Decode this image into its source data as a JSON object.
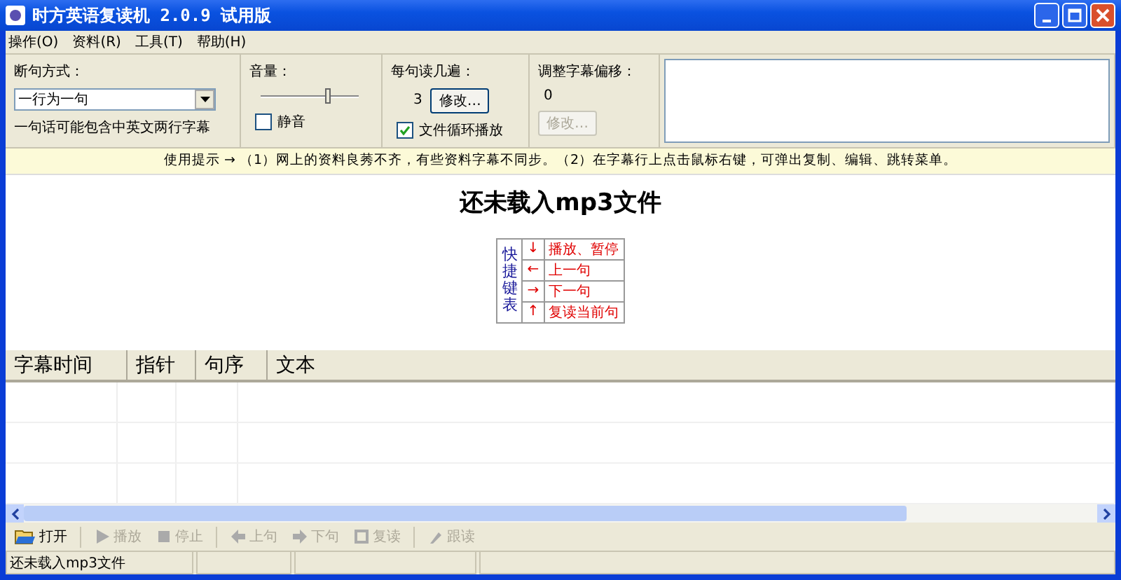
{
  "window": {
    "title": "时方英语复读机 2.0.9 试用版"
  },
  "menu": [
    "操作(O)",
    "资料(R)",
    "工具(T)",
    "帮助(H)"
  ],
  "split_mode": {
    "label": "断句方式：",
    "value": "一行为一句",
    "note": "一句话可能包含中英文两行字幕"
  },
  "volume": {
    "label": "音量：",
    "level": 0.68,
    "mute": {
      "label": "静音",
      "checked": false
    }
  },
  "repeat": {
    "label": "每句读几遍：",
    "count": "3",
    "button": "修改…",
    "loop": {
      "label": "文件循环播放",
      "checked": true
    }
  },
  "offset": {
    "label": "调整字幕偏移：",
    "value": "0",
    "button": {
      "label": "修改…",
      "disabled": true
    }
  },
  "hint": "使用提示 → （1）网上的资料良莠不齐，有些资料字幕不同步。（2）在字幕行上点击鼠标右键，可弹出复制、编辑、跳转菜单。",
  "message": "还未载入mp3文件",
  "shortcuts": {
    "title": "快捷键表",
    "rows": [
      {
        "key": "↓",
        "action": "播放、暂停"
      },
      {
        "key": "←",
        "action": "上一句"
      },
      {
        "key": "→",
        "action": "下一句"
      },
      {
        "key": "↑",
        "action": "复读当前句"
      }
    ]
  },
  "table": {
    "columns": [
      "字幕时间",
      "指针",
      "句序",
      "文本"
    ]
  },
  "toolbar": [
    {
      "kind": "open",
      "label": "打开",
      "disabled": false
    },
    {
      "kind": "play",
      "label": "播放",
      "disabled": true
    },
    {
      "kind": "stop",
      "label": "停止",
      "disabled": true
    },
    {
      "kind": "prev",
      "label": "上句",
      "disabled": true
    },
    {
      "kind": "next",
      "label": "下句",
      "disabled": true
    },
    {
      "kind": "repeat",
      "label": "复读",
      "disabled": true
    },
    {
      "kind": "follow",
      "label": "跟读",
      "disabled": true
    }
  ],
  "status_bar": [
    "还未载入mp3文件"
  ]
}
